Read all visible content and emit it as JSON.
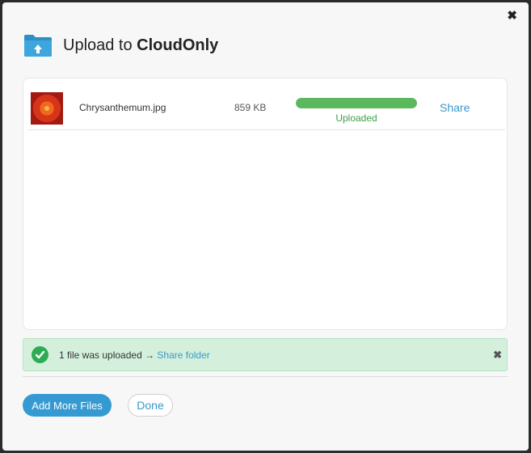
{
  "dialog": {
    "close_icon": "✖",
    "title_prefix": "Upload to ",
    "title_service": "CloudOnly",
    "icon": "folder-upload-icon"
  },
  "files": [
    {
      "name": "Chrysanthemum.jpg",
      "size": "859 KB",
      "progress_percent": 100,
      "status": "Uploaded",
      "action": "Share"
    }
  ],
  "notice": {
    "text": "1 file was uploaded → ",
    "link": "Share folder",
    "close_icon": "✖"
  },
  "buttons": {
    "add_more": "Add More Files",
    "done": "Done"
  },
  "colors": {
    "accent": "#359ad1",
    "success": "#2eac53",
    "progress": "#5cb85c"
  }
}
